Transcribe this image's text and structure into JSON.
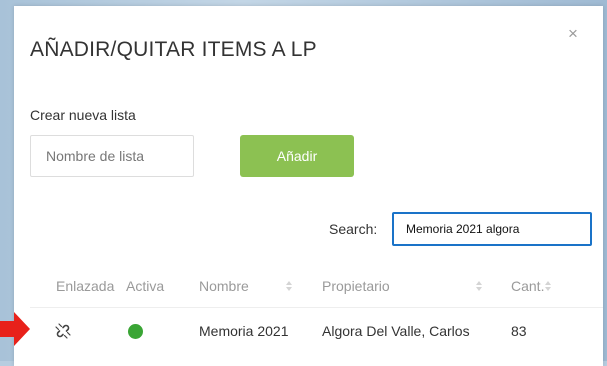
{
  "modal": {
    "title": "AÑADIR/QUITAR ITEMS A LP",
    "close_glyph": "×"
  },
  "new_list": {
    "label": "Crear nueva lista",
    "input_placeholder": "Nombre de lista",
    "input_value": "",
    "add_button_label": "Añadir"
  },
  "search": {
    "label": "Search:",
    "value": "Memoria 2021 algora"
  },
  "table": {
    "columns": [
      "Enlazada",
      "Activa",
      "Nombre",
      "Propietario",
      "Cant."
    ],
    "rows": [
      {
        "linked_icon": "unlink-icon",
        "active": true,
        "name": "Memoria 2021",
        "owner": "Algora Del Valle, Carlos",
        "count": "83"
      }
    ]
  },
  "colors": {
    "accent_green": "#8cc152",
    "active_dot": "#3aa535",
    "search_focus": "#1a73c8",
    "pointer_arrow": "#e8211a"
  }
}
